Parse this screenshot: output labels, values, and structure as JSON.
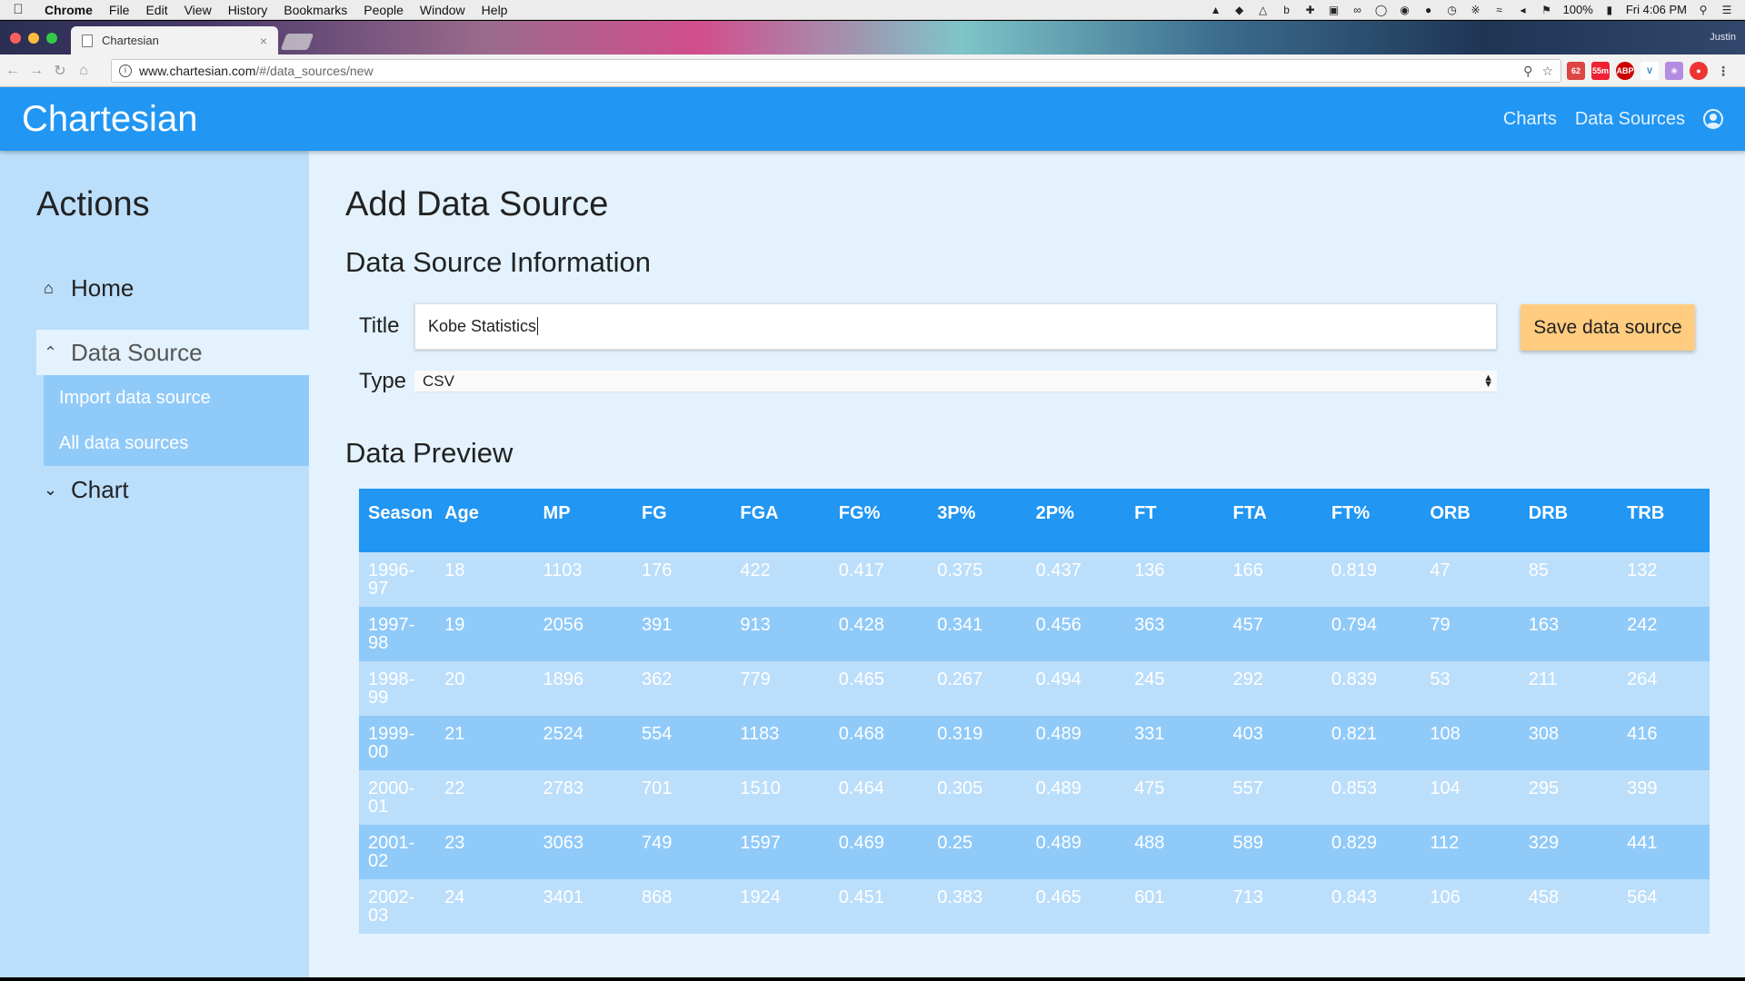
{
  "menubar": {
    "app": "Chrome",
    "items": [
      "File",
      "Edit",
      "View",
      "History",
      "Bookmarks",
      "People",
      "Window",
      "Help"
    ],
    "battery": "100%",
    "clock": "Fri 4:06 PM"
  },
  "browser": {
    "tab_title": "Chartesian",
    "profile": "Justin",
    "url_host": "www.chartesian.com",
    "url_path": "/#/data_sources/new",
    "extension_badges": [
      "62",
      "55m",
      "ABP"
    ]
  },
  "app": {
    "brand": "Chartesian",
    "nav": {
      "charts": "Charts",
      "data_sources": "Data Sources"
    }
  },
  "sidebar": {
    "heading": "Actions",
    "home": "Home",
    "data_source": "Data Source",
    "import": "Import data source",
    "all": "All data sources",
    "chart": "Chart"
  },
  "form": {
    "page_title": "Add Data Source",
    "section_info": "Data Source Information",
    "title_label": "Title",
    "title_value": "Kobe Statistics",
    "type_label": "Type",
    "type_value": "CSV",
    "save_label": "Save data source",
    "section_preview": "Data Preview"
  },
  "table": {
    "headers": [
      "Season",
      "Age",
      "MP",
      "FG",
      "FGA",
      "FG%",
      "3P%",
      "2P%",
      "FT",
      "FTA",
      "FT%",
      "ORB",
      "DRB",
      "TRB"
    ],
    "rows": [
      [
        "1996-97",
        "18",
        "1103",
        "176",
        "422",
        "0.417",
        "0.375",
        "0.437",
        "136",
        "166",
        "0.819",
        "47",
        "85",
        "132"
      ],
      [
        "1997-98",
        "19",
        "2056",
        "391",
        "913",
        "0.428",
        "0.341",
        "0.456",
        "363",
        "457",
        "0.794",
        "79",
        "163",
        "242"
      ],
      [
        "1998-99",
        "20",
        "1896",
        "362",
        "779",
        "0.465",
        "0.267",
        "0.494",
        "245",
        "292",
        "0.839",
        "53",
        "211",
        "264"
      ],
      [
        "1999-00",
        "21",
        "2524",
        "554",
        "1183",
        "0.468",
        "0.319",
        "0.489",
        "331",
        "403",
        "0.821",
        "108",
        "308",
        "416"
      ],
      [
        "2000-01",
        "22",
        "2783",
        "701",
        "1510",
        "0.464",
        "0.305",
        "0.489",
        "475",
        "557",
        "0.853",
        "104",
        "295",
        "399"
      ],
      [
        "2001-02",
        "23",
        "3063",
        "749",
        "1597",
        "0.469",
        "0.25",
        "0.489",
        "488",
        "589",
        "0.829",
        "112",
        "329",
        "441"
      ],
      [
        "2002-03",
        "24",
        "3401",
        "868",
        "1924",
        "0.451",
        "0.383",
        "0.465",
        "601",
        "713",
        "0.843",
        "106",
        "458",
        "564"
      ]
    ]
  },
  "colors": {
    "primary": "#2196f3",
    "sidebar": "#bbdefb",
    "background": "#e3f2fd",
    "sub_item": "#90caf9",
    "save_button": "#ffcc80"
  }
}
